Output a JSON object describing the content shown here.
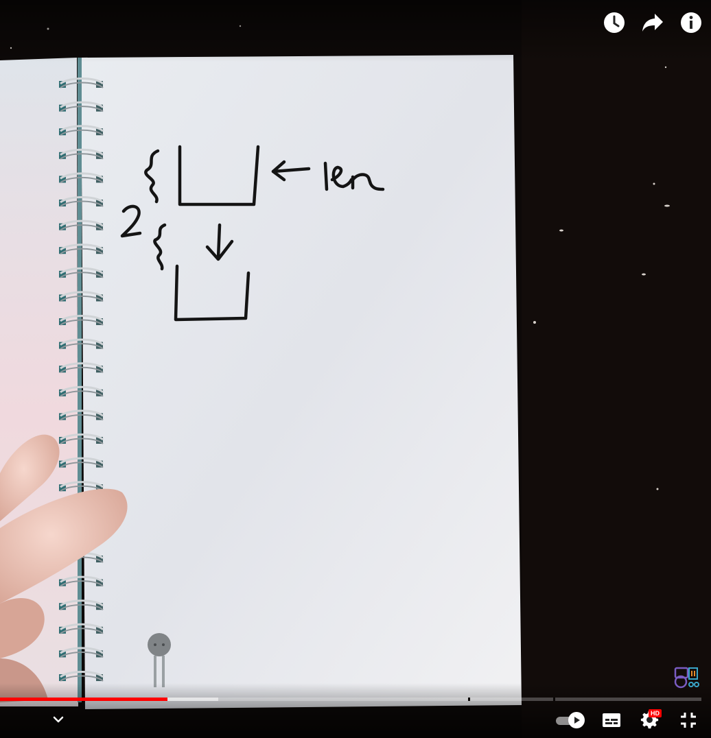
{
  "player": {
    "progress_fraction": 0.239,
    "buffered_fraction": 0.311,
    "chapter_marks": [
      0.667,
      0.789
    ],
    "accent_color": "#ff0000",
    "hd_badge": "HD",
    "autoplay_on": true,
    "icons": {
      "watch_later": "clock-icon",
      "share": "share-arrow-icon",
      "info": "info-icon",
      "collapse": "chevron-down-icon",
      "autoplay": "play-icon",
      "subtitles": "subtitles-icon",
      "settings": "gear-icon",
      "exit_fullscreen": "exit-fullscreen-icon"
    }
  },
  "notebook": {
    "handwritten_label": "len",
    "handwritten_number": "2"
  }
}
